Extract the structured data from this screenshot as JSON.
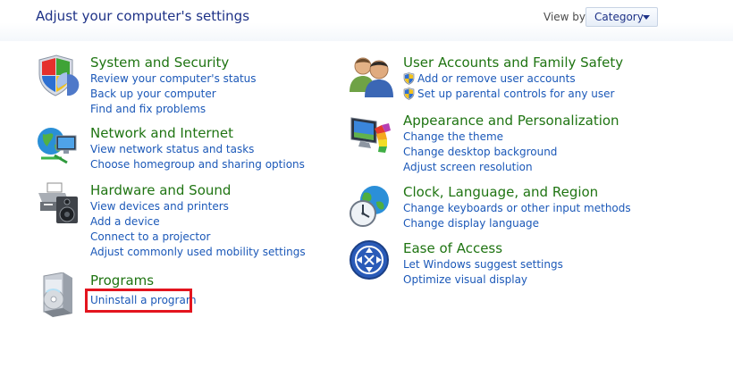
{
  "header": {
    "title": "Adjust your computer's settings",
    "view_by_label": "View by:",
    "view_by_value": "Category"
  },
  "categories": [
    {
      "title": "System and Security",
      "icon": "shield-pie-icon",
      "links": [
        "Review your computer's status",
        "Back up your computer",
        "Find and fix problems"
      ]
    },
    {
      "title": "Network and Internet",
      "icon": "globe-network-icon",
      "links": [
        "View network status and tasks",
        "Choose homegroup and sharing options"
      ]
    },
    {
      "title": "Hardware and Sound",
      "icon": "printer-speaker-icon",
      "links": [
        "View devices and printers",
        "Add a device",
        "Connect to a projector",
        "Adjust commonly used mobility settings"
      ]
    },
    {
      "title": "Programs",
      "icon": "programs-box-icon",
      "links": [
        "Uninstall a program"
      ]
    },
    {
      "title": "User Accounts and Family Safety",
      "icon": "users-icon",
      "links": [
        "Add or remove user accounts",
        "Set up parental controls for any user"
      ]
    },
    {
      "title": "Appearance and Personalization",
      "icon": "monitor-palette-icon",
      "links": [
        "Change the theme",
        "Change desktop background",
        "Adjust screen resolution"
      ]
    },
    {
      "title": "Clock, Language, and Region",
      "icon": "clock-globe-icon",
      "links": [
        "Change keyboards or other input methods",
        "Change display language"
      ]
    },
    {
      "title": "Ease of Access",
      "icon": "ease-of-access-icon",
      "links": [
        "Let Windows suggest settings",
        "Optimize visual display"
      ]
    }
  ],
  "highlight_color": "#e3141e",
  "colors": {
    "title": "#1e3287",
    "category": "#1f7412",
    "link": "#1b58b8"
  }
}
